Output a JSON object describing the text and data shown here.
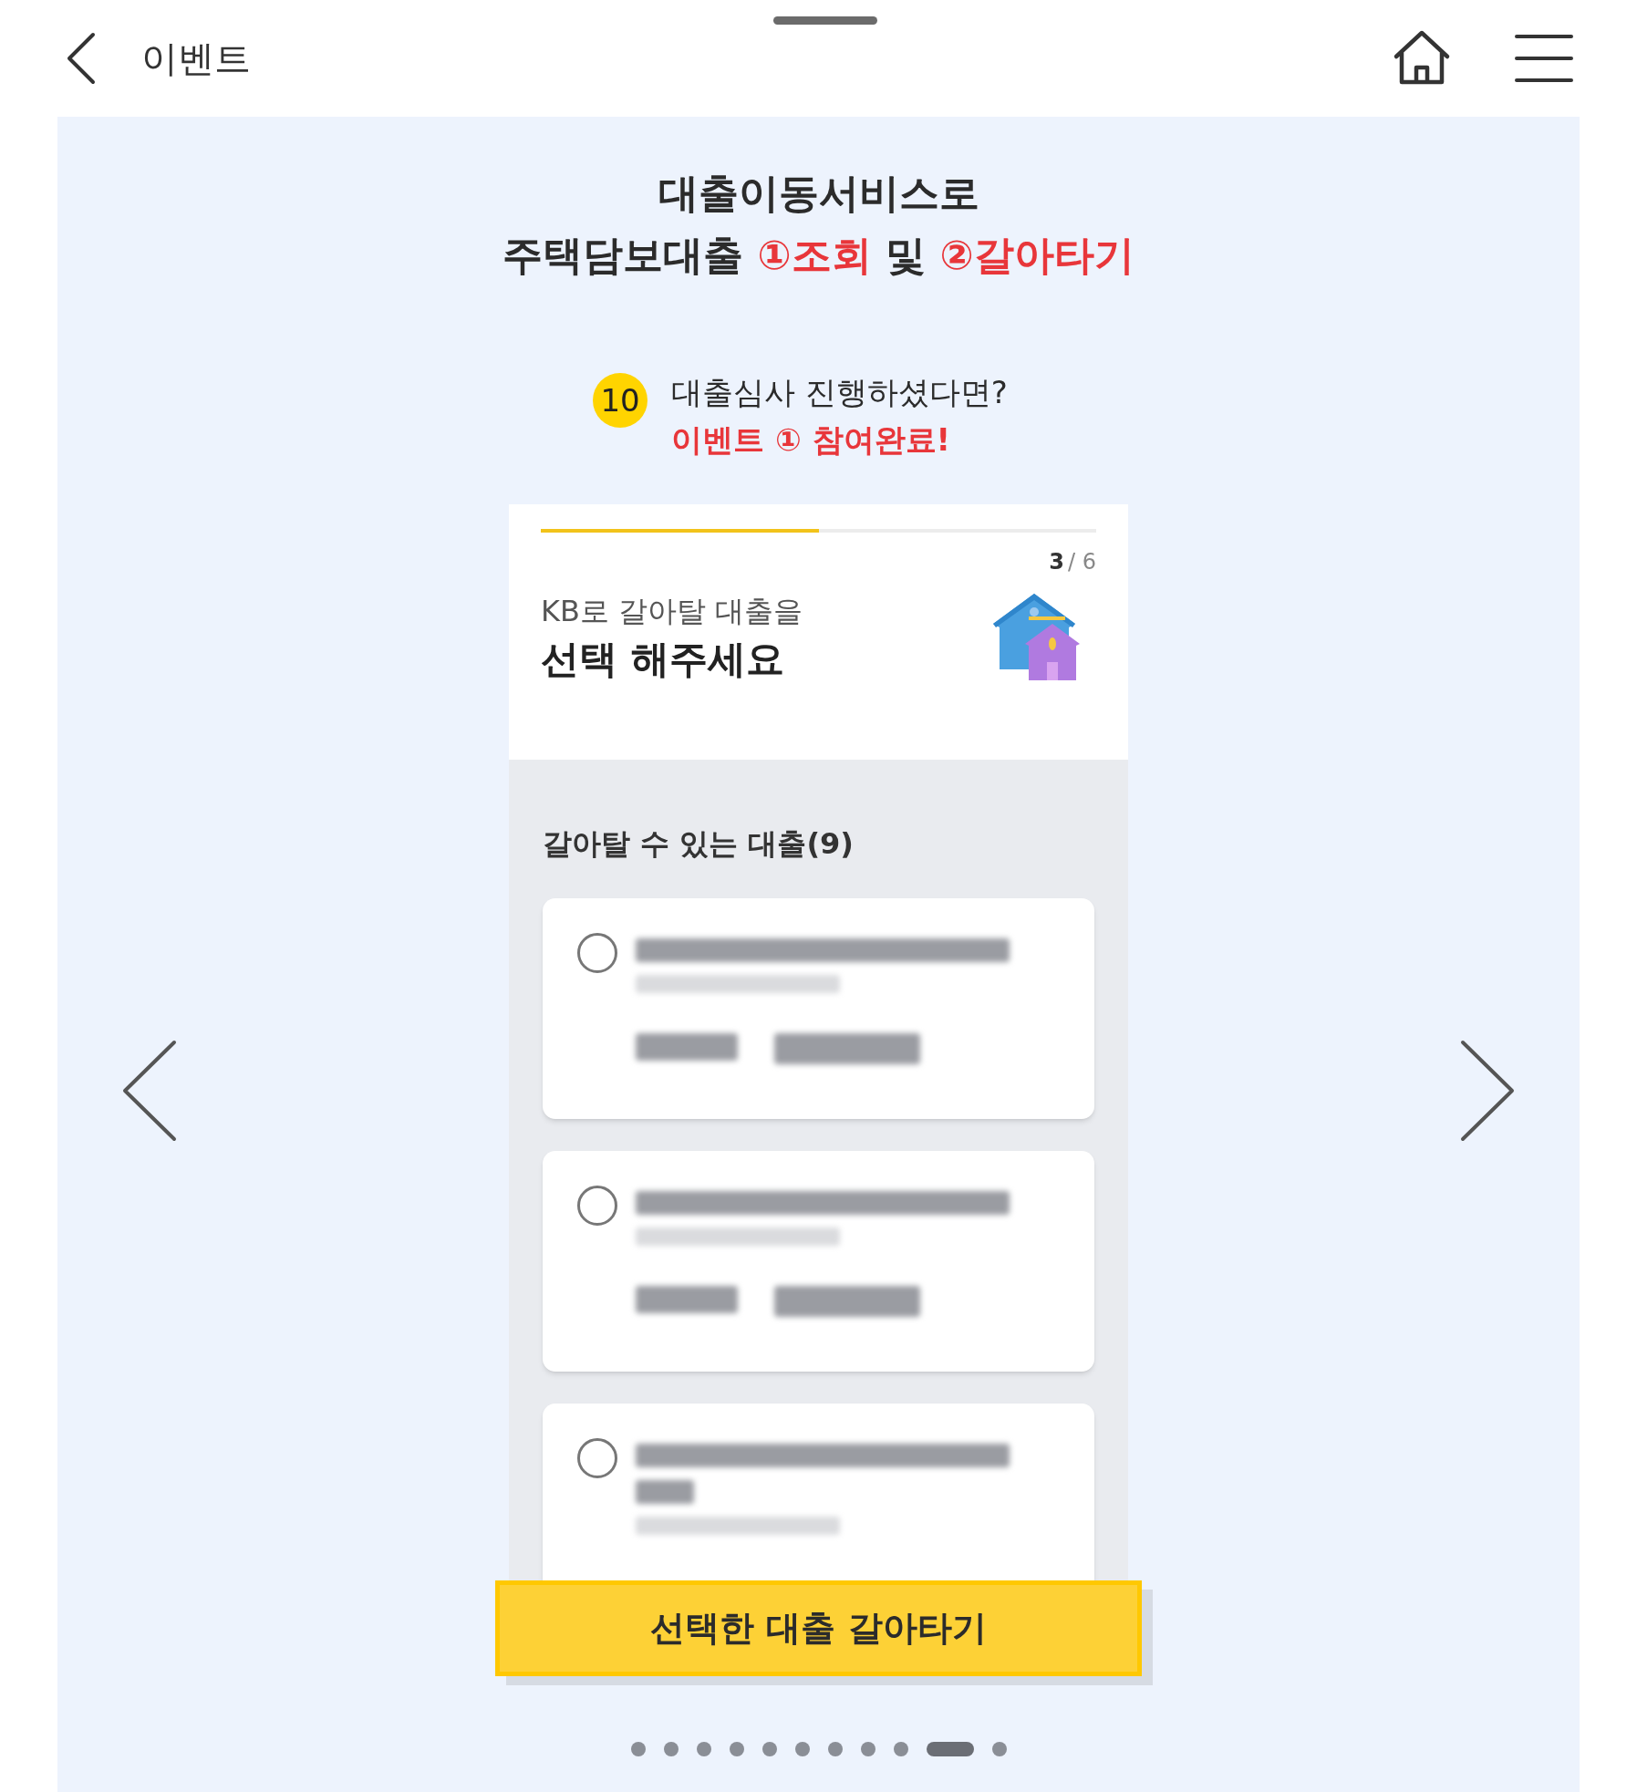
{
  "header": {
    "title": "이벤트"
  },
  "headline": {
    "line_1": "대출이동서비스로",
    "line_2": [
      {
        "text": "주택담보대출 ",
        "highlight": false
      },
      {
        "text": "①조회",
        "highlight": true
      },
      {
        "text": " 및 ",
        "highlight": false
      },
      {
        "text": "②갈아타기",
        "highlight": true
      }
    ]
  },
  "step": {
    "number": "10",
    "text": "대출심사 진행하셨다면?",
    "note": "이벤트 ① 참여완료!"
  },
  "phone": {
    "progress": {
      "level": 0.5
    },
    "step_current": "3",
    "step_total": "/ 6",
    "subtitle": "KB로 갈아탈 대출을",
    "title": "선택 해주세요",
    "list_label": "갈아탈 수 있는 대출(9)",
    "loans": [
      {
        "selected": false,
        "kind": "short"
      },
      {
        "selected": false,
        "kind": "short"
      },
      {
        "selected": false,
        "kind": "wrapped"
      }
    ],
    "button": "선택한 대출 갈아타기"
  },
  "pager": [
    {
      "selected": false
    },
    {
      "selected": false
    },
    {
      "selected": false
    },
    {
      "selected": false
    },
    {
      "selected": false
    },
    {
      "selected": false
    },
    {
      "selected": false
    },
    {
      "selected": false
    },
    {
      "selected": false
    },
    {
      "selected": true
    },
    {
      "selected": false
    }
  ]
}
